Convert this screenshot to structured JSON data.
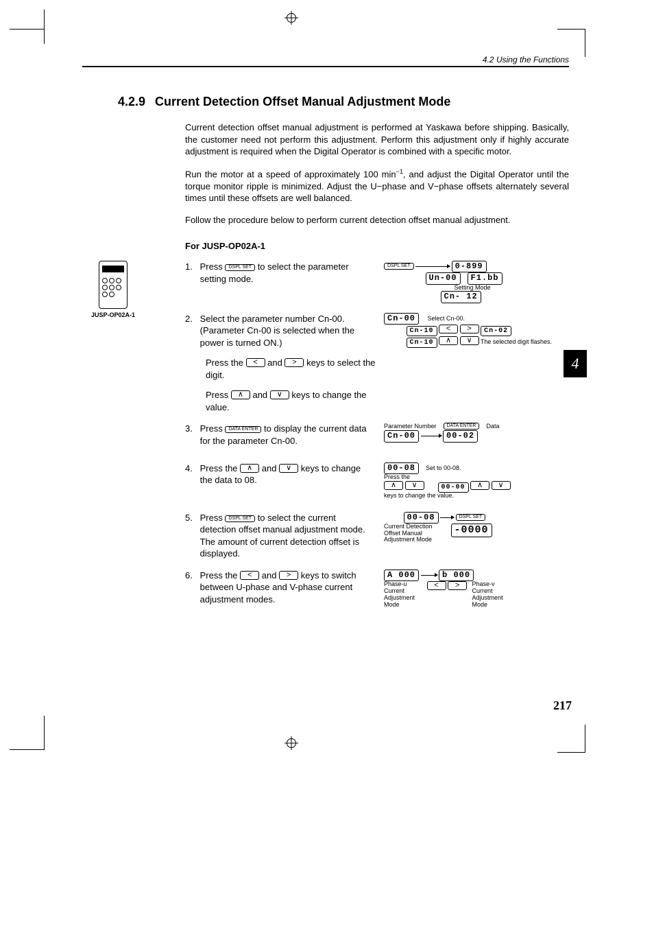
{
  "running_head": "4.2 Using the Functions",
  "section": {
    "number": "4.2.9",
    "title": "Current Detection Offset Manual Adjustment Mode"
  },
  "paragraphs": {
    "p1": "Current detection offset manual adjustment is performed at Yaskawa before shipping. Basically, the customer need not perform this adjustment. Perform this adjustment only if highly accurate adjustment is required when the Digital Operator is combined with a specific motor.",
    "p2a": "Run the motor at a speed of approximately 100 min",
    "p2_sup": "−1",
    "p2b": ", and adjust the Digital Operator until the torque monitor ripple is minimized. Adjust the U−phase and V−phase offsets alternately several times until these offsets are well balanced.",
    "p3": "Follow the procedure below to perform current detection offset manual adjustment."
  },
  "subhead": "For JUSP-OP02A-1",
  "side_label": "JUSP-OP02A-1",
  "chapter_tab": "4",
  "page_number": "217",
  "keys": {
    "dspl": "DSPL SET",
    "data": "DATA ENTER",
    "left": "<",
    "right": ">",
    "up": "∧",
    "down": "∨"
  },
  "steps": {
    "s1": {
      "no": "1.",
      "a": "Press ",
      "b": " to select the parameter setting mode."
    },
    "s2": {
      "no": "2.",
      "text": "Select the parameter number Cn-00. (Parameter Cn-00 is selected when the power is turned ON.)"
    },
    "s2a": {
      "a": "Press the ",
      "mid": " and ",
      "b": " keys to select the digit."
    },
    "s2b": {
      "a": "Press ",
      "mid": " and ",
      "b": " keys to change the value."
    },
    "s3": {
      "no": "3.",
      "a": "Press ",
      "b": " to display the current data for the parameter Cn-00."
    },
    "s4": {
      "no": "4.",
      "a": "Press the ",
      "mid": " and ",
      "b": " keys to change the data to 08."
    },
    "s5": {
      "no": "5.",
      "a": "Press ",
      "b": " to select the current detection offset manual adjustment mode.",
      "c": "The amount of current detection offset is displayed."
    },
    "s6": {
      "no": "6.",
      "a": "Press the ",
      "mid": " and ",
      "b": " keys to switch between U-phase and V-phase current adjustment modes."
    }
  },
  "illus": {
    "i1": {
      "d1": "0-899",
      "d2": "Un-00",
      "d3": "F1.bb",
      "d4": "Cn- 12",
      "label": "Setting Mode"
    },
    "i2": {
      "d1": "Cn-00",
      "label1": "Select Cn-00.",
      "d2": "Cn-10",
      "d3": "Cn-02",
      "d4": "Cn-10",
      "label2": "The selected digit flashes."
    },
    "i3": {
      "d1": "Cn-00",
      "d2": "00-02",
      "label1": "Parameter Number",
      "label2": "Data"
    },
    "i4": {
      "d1": "00-08",
      "label1": "Set to 00-08.",
      "d2": "00-00",
      "label2": "Press the",
      "label3": "keys to change the value."
    },
    "i5": {
      "d1": "00-08",
      "d2": "-0000",
      "label1": "Current Detection Offset Manual Adjustment Mode"
    },
    "i6": {
      "d1": "A 000",
      "d2": "b 000",
      "label1": "Phase-u Current Adjustment Mode",
      "label2": "Phase-v Current Adjustment Mode"
    }
  }
}
